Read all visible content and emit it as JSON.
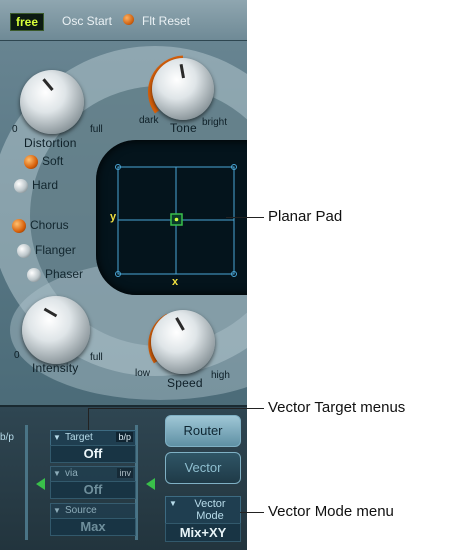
{
  "topbar": {
    "free_label": "free",
    "osc_start_label": "Osc Start",
    "flt_reset_label": "Flt Reset"
  },
  "knobs": {
    "distortion": {
      "label": "Distortion",
      "min": "0",
      "max": "full"
    },
    "tone": {
      "label": "Tone",
      "min": "dark",
      "max": "bright"
    },
    "intensity": {
      "label": "Intensity",
      "min": "0",
      "max": "full"
    },
    "speed": {
      "label": "Speed",
      "min": "low",
      "max": "high"
    }
  },
  "distortion_modes": [
    {
      "label": "Soft",
      "active": true
    },
    {
      "label": "Hard",
      "active": false
    }
  ],
  "effect_modes": [
    {
      "label": "Chorus",
      "active": true
    },
    {
      "label": "Flanger",
      "active": false
    },
    {
      "label": "Phaser",
      "active": false
    }
  ],
  "pad": {
    "x_label": "x",
    "y_label": "y"
  },
  "vector": {
    "target_menu": {
      "label": "Target",
      "tag": "b/p",
      "value": "Off"
    },
    "via_menu": {
      "label": "via",
      "tag": "inv",
      "value": "Off"
    },
    "source_menu": {
      "label": "Source",
      "value": "Max"
    },
    "left_tag": "b/p",
    "router_button": "Router",
    "vector_button": "Vector",
    "mode_menu": {
      "label": "Vector Mode",
      "value": "Mix+XY"
    }
  },
  "callouts": {
    "planar_pad": "Planar Pad",
    "vector_target": "Vector Target menus",
    "vector_mode": "Vector Mode menu"
  },
  "colors": {
    "accent_orange": "#d7600a",
    "display_text": "#d8ff3a",
    "pad_line": "#4aa6d6",
    "arrow_green": "#39c04a"
  }
}
